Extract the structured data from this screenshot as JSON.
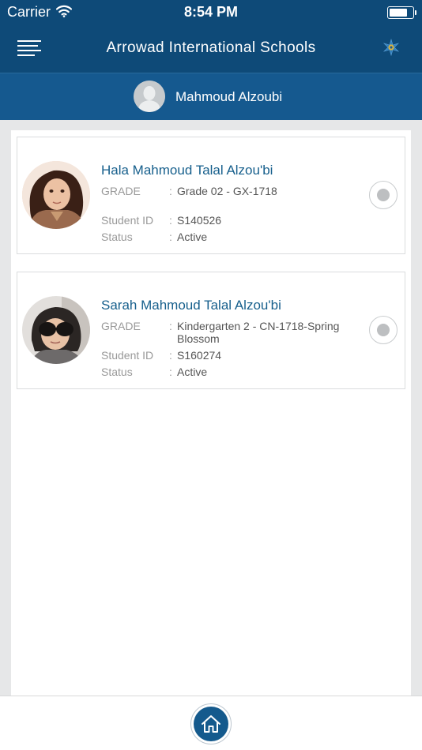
{
  "status_bar": {
    "carrier": "Carrier",
    "time": "8:54 PM",
    "battery_level": 0.8,
    "icons": [
      "wifi-icon",
      "battery-icon"
    ]
  },
  "header": {
    "title": "Arrowad International Schools",
    "menu_icon": "hamburger-menu-icon",
    "logo_icon": "school-logo-icon"
  },
  "user": {
    "name": "Mahmoud Alzoubi",
    "avatar_icon": "user-silhouette-icon"
  },
  "students": [
    {
      "name": "Hala Mahmoud Talal Alzou'bi",
      "grade_label": "GRADE",
      "grade_value": "Grade 02 - GX-1718",
      "id_label": "Student ID",
      "id_value": "S140526",
      "status_label": "Status",
      "status_value": "Active",
      "selected": false
    },
    {
      "name": "Sarah Mahmoud Talal Alzou'bi",
      "grade_label": "GRADE",
      "grade_value": "Kindergarten 2 - CN-1718-Spring Blossom",
      "id_label": "Student ID",
      "id_value": "S160274",
      "status_label": "Status",
      "status_value": "Active",
      "selected": false
    }
  ],
  "colon": ":",
  "footer": {
    "home_icon": "home-icon"
  },
  "colors": {
    "header_bg": "#0e4a78",
    "userbar_bg": "#15598f",
    "student_name": "#165f8c",
    "page_bg": "#e6e7e8"
  }
}
